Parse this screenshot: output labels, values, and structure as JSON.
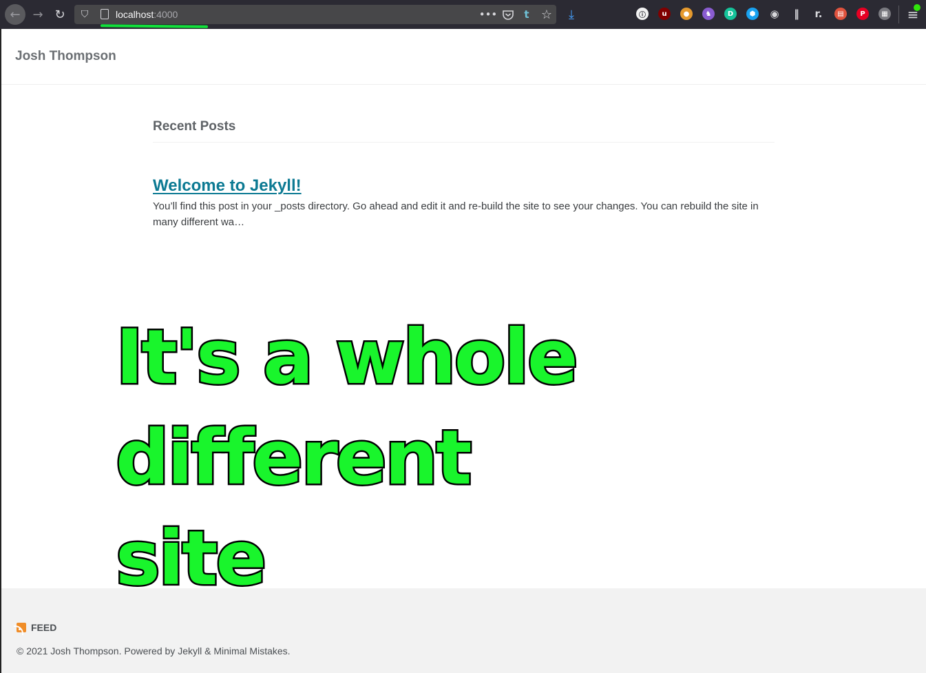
{
  "browser": {
    "url_host": "localhost",
    "url_port": ":4000",
    "icons": [
      "back-arrow-icon",
      "forward-arrow-icon",
      "reload-icon",
      "tracking-shield-icon",
      "page-icon",
      "more-icon",
      "pocket-icon",
      "tumblr-icon",
      "bookmark-star-icon",
      "download-icon"
    ],
    "more_glyph": "•••",
    "tumblr_glyph": "t",
    "star_glyph": "☆",
    "download_glyph": "⤓",
    "menu_glyph": "≡",
    "extensions": [
      {
        "name": "onepassword-icon",
        "glyph": "ⓘ",
        "color": "#f2f2f2"
      },
      {
        "name": "ublock-icon",
        "glyph": "u",
        "color": "#800000"
      },
      {
        "name": "cookie-icon",
        "glyph": "●",
        "color": "#e69a2e"
      },
      {
        "name": "octo-icon",
        "glyph": "♞",
        "color": "#8a5cd1"
      },
      {
        "name": "grammarly-icon",
        "glyph": "D",
        "color": "#15c39a"
      },
      {
        "name": "hex-icon",
        "glyph": "⬢",
        "color": "#19a2f0"
      },
      {
        "name": "account-icon",
        "glyph": "◉",
        "color": "#d7d7db"
      },
      {
        "name": "multi-columns-icon",
        "glyph": "‖",
        "color": "#d7d7db"
      },
      {
        "name": "r-icon",
        "glyph": "r.",
        "color": "#d7d7db"
      },
      {
        "name": "tabs-icon",
        "glyph": "▤",
        "color": "#e0533e"
      },
      {
        "name": "pinterest-icon",
        "glyph": "P",
        "color": "#e60023"
      },
      {
        "name": "reader-icon",
        "glyph": "▦",
        "color": "#7a7a80"
      }
    ]
  },
  "site": {
    "title": "Josh Thompson"
  },
  "main": {
    "section_title": "Recent Posts",
    "posts": [
      {
        "title": "Welcome to Jekyll!",
        "excerpt": "You’ll find this post in your _posts directory. Go ahead and edit it and re-build the site to see your changes. You can rebuild the site in many different wa…"
      }
    ]
  },
  "overlay": {
    "line1": "It's a whole",
    "line2": "different site"
  },
  "footer": {
    "feed_label": "FEED",
    "copyright": "© 2021 Josh Thompson. Powered by Jekyll & Minimal Mistakes."
  },
  "colors": {
    "link": "#0c7a93",
    "overlay_fill": "#19f52c",
    "overlay_stroke": "#000000",
    "rss": "#f08d28",
    "url_underline": "#10e13a"
  }
}
